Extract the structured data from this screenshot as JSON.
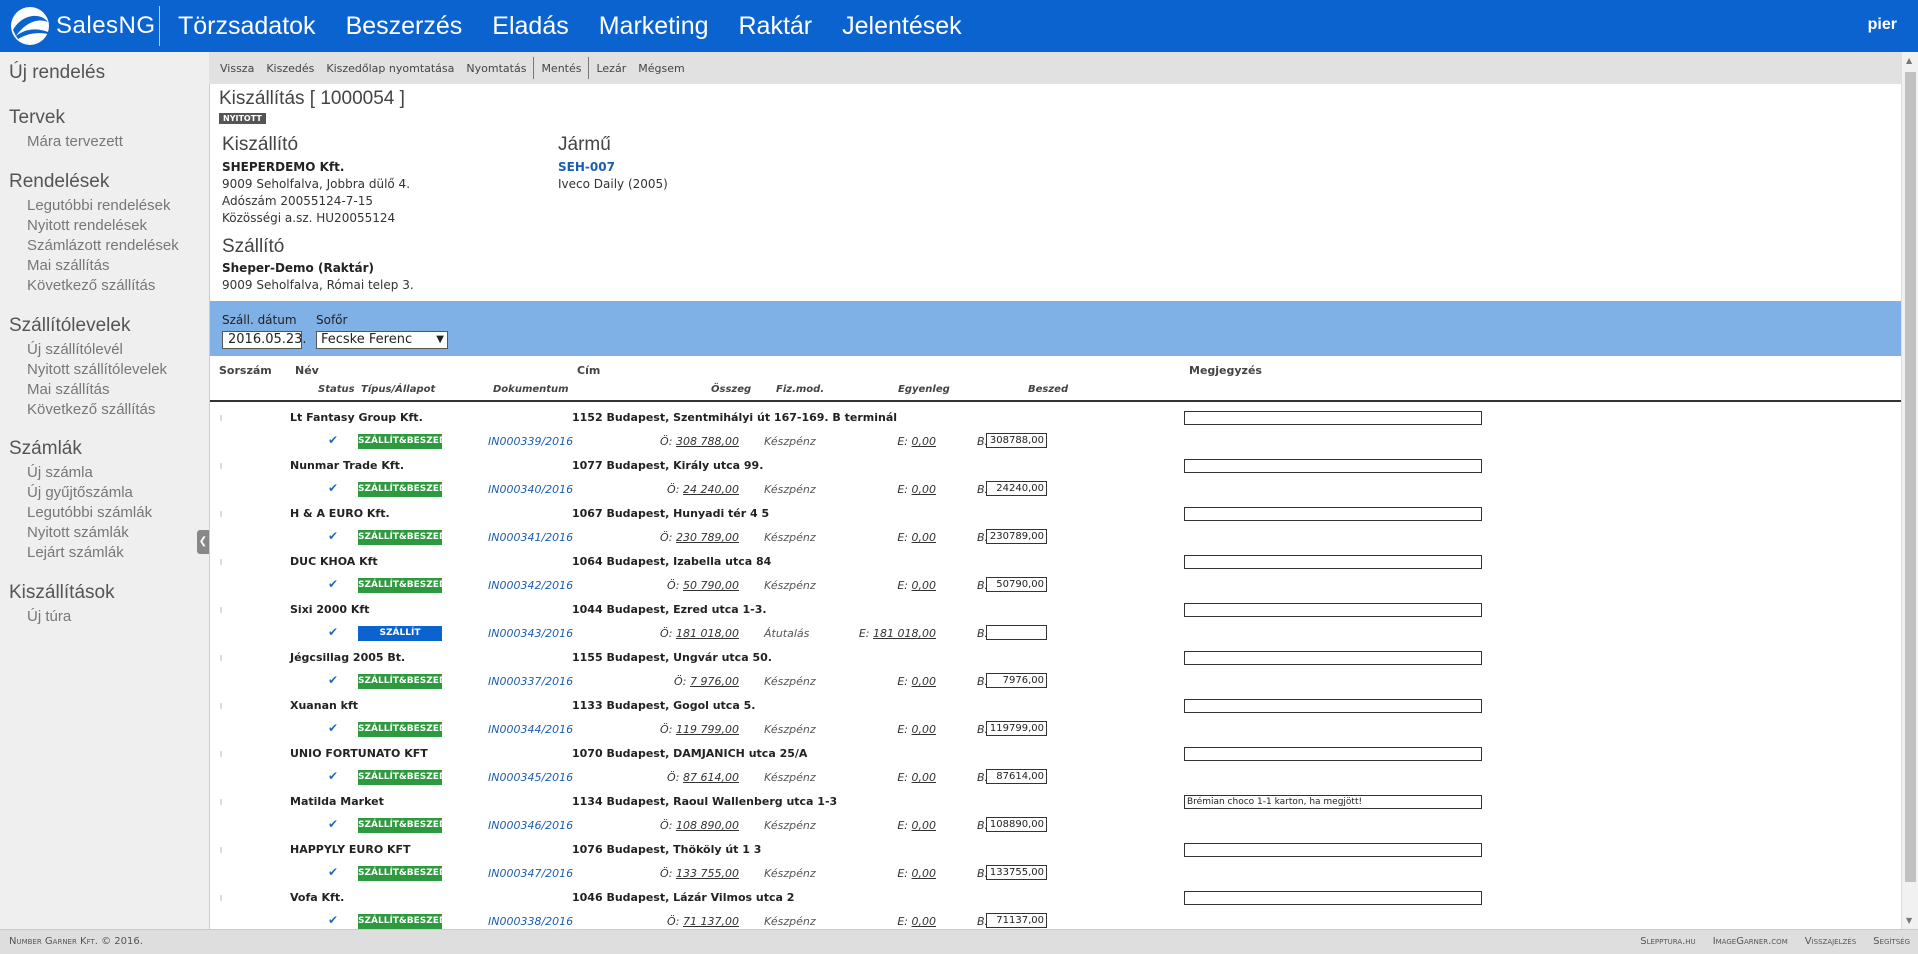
{
  "app": {
    "brand": "SalesNG",
    "user": "pier"
  },
  "nav": [
    "Törzsadatok",
    "Beszerzés",
    "Eladás",
    "Marketing",
    "Raktár",
    "Jelentések"
  ],
  "sidebar": [
    {
      "label": "Új rendelés",
      "items": []
    },
    {
      "label": "Tervek",
      "items": [
        "Mára tervezett"
      ]
    },
    {
      "label": "Rendelések",
      "items": [
        "Legutóbbi rendelések",
        "Nyitott rendelések",
        "Számlázott rendelések",
        "Mai szállítás",
        "Következő szállítás"
      ]
    },
    {
      "label": "Szállítólevelek",
      "items": [
        "Új szállítólevél",
        "Nyitott szállítólevelek",
        "Mai szállítás",
        "Következő szállítás"
      ]
    },
    {
      "label": "Számlák",
      "items": [
        "Új számla",
        "Új gyűjtőszámla",
        "Legutóbbi számlák",
        "Nyitott számlák",
        "Lejárt számlák"
      ]
    },
    {
      "label": "Kiszállítások",
      "items": [
        "Új túra"
      ]
    }
  ],
  "toolbar": [
    "Vissza",
    "Kiszedés",
    "Kiszedőlap nyomtatása",
    "Nyomtatás",
    "Mentés",
    "Lezár",
    "Mégsem"
  ],
  "page": {
    "title": "Kiszállítás [ 1000054 ]",
    "status": "NYITOTT"
  },
  "kiszallito": {
    "heading": "Kiszállító",
    "name": "SHEPERDEMO Kft.",
    "lines": [
      "9009 Seholfalva, Jobbra dülő 4.",
      "Adószám 20055124-7-15",
      "Közösségi a.sz. HU20055124"
    ]
  },
  "jarmu": {
    "heading": "Jármű",
    "plate": "SEH-007",
    "model": "Iveco Daily (2005)"
  },
  "szallito": {
    "heading": "Szállító",
    "name": "Sheper-Demo (Raktár)",
    "address": "9009 Seholfalva, Római telep 3."
  },
  "filters": {
    "date_label": "Száll. dátum",
    "date_value": "2016.05.23.",
    "driver_label": "Sofőr",
    "driver_value": "Fecske Ferenc"
  },
  "columns": {
    "sorszam": "Sorszám",
    "nev": "Név",
    "cim": "Cím",
    "megjegyzes": "Megjegyzés",
    "status": "Status",
    "tipus": "Típus/Állapot",
    "dokumentum": "Dokumentum",
    "osszeg": "Összeg",
    "fizmod": "Fiz.mod.",
    "egyenleg": "Egyenleg",
    "beszed": "Beszed"
  },
  "prefixes": {
    "o": "Ö:",
    "e": "E:",
    "b": "B:"
  },
  "rows": [
    {
      "name": "Lt Fantasy Group Kft.",
      "address": "1152 Budapest, Szentmihályi út 167-169. B terminál",
      "badge": "SZÁLLÍT&BESZED",
      "badge_color": "#2e9a3e",
      "doc": "IN000339/2016",
      "osszeg": "308 788,00",
      "fizmod": "Készpénz",
      "egyenleg": "0,00",
      "beszed": "308788,00",
      "note": ""
    },
    {
      "name": "Nunmar Trade Kft.",
      "address": "1077 Budapest, Király utca 99.",
      "badge": "SZÁLLÍT&BESZED",
      "badge_color": "#2e9a3e",
      "doc": "IN000340/2016",
      "osszeg": "24 240,00",
      "fizmod": "Készpénz",
      "egyenleg": "0,00",
      "beszed": "24240,00",
      "note": ""
    },
    {
      "name": "H & A EURO Kft.",
      "address": "1067 Budapest, Hunyadi tér 4 5",
      "badge": "SZÁLLÍT&BESZED",
      "badge_color": "#2e9a3e",
      "doc": "IN000341/2016",
      "osszeg": "230 789,00",
      "fizmod": "Készpénz",
      "egyenleg": "0,00",
      "beszed": "230789,00",
      "note": ""
    },
    {
      "name": "DUC KHOA Kft",
      "address": "1064 Budapest, Izabella utca 84",
      "badge": "SZÁLLÍT&BESZED",
      "badge_color": "#2e9a3e",
      "doc": "IN000342/2016",
      "osszeg": "50 790,00",
      "fizmod": "Készpénz",
      "egyenleg": "0,00",
      "beszed": "50790,00",
      "note": ""
    },
    {
      "name": "Sixi 2000 Kft",
      "address": "1044 Budapest, Ezred utca 1-3.",
      "badge": "SZÁLLÍT",
      "badge_color": "#0b63cf",
      "doc": "IN000343/2016",
      "osszeg": "181 018,00",
      "fizmod": "Átutalás",
      "egyenleg": "181 018,00",
      "beszed": "",
      "note": ""
    },
    {
      "name": "Jégcsillag 2005 Bt.",
      "address": "1155 Budapest, Ungvár utca 50.",
      "badge": "SZÁLLÍT&BESZED",
      "badge_color": "#2e9a3e",
      "doc": "IN000337/2016",
      "osszeg": "7 976,00",
      "fizmod": "Készpénz",
      "egyenleg": "0,00",
      "beszed": "7976,00",
      "note": ""
    },
    {
      "name": "Xuanan kft",
      "address": "1133 Budapest, Gogol utca 5.",
      "badge": "SZÁLLÍT&BESZED",
      "badge_color": "#2e9a3e",
      "doc": "IN000344/2016",
      "osszeg": "119 799,00",
      "fizmod": "Készpénz",
      "egyenleg": "0,00",
      "beszed": "119799,00",
      "note": ""
    },
    {
      "name": "UNIO FORTUNATO KFT",
      "address": "1070 Budapest, DAMJANICH utca 25/A",
      "badge": "SZÁLLÍT&BESZED",
      "badge_color": "#2e9a3e",
      "doc": "IN000345/2016",
      "osszeg": "87 614,00",
      "fizmod": "Készpénz",
      "egyenleg": "0,00",
      "beszed": "87614,00",
      "note": ""
    },
    {
      "name": "Matilda Market",
      "address": "1134 Budapest, Raoul Wallenberg utca 1-3",
      "badge": "SZÁLLÍT&BESZED",
      "badge_color": "#2e9a3e",
      "doc": "IN000346/2016",
      "osszeg": "108 890,00",
      "fizmod": "Készpénz",
      "egyenleg": "0,00",
      "beszed": "108890,00",
      "note": "Brémian choco 1-1 karton, ha megjött!"
    },
    {
      "name": "HAPPYLY EURO KFT",
      "address": "1076 Budapest, Thököly út 1 3",
      "badge": "SZÁLLÍT&BESZED",
      "badge_color": "#2e9a3e",
      "doc": "IN000347/2016",
      "osszeg": "133 755,00",
      "fizmod": "Készpénz",
      "egyenleg": "0,00",
      "beszed": "133755,00",
      "note": ""
    },
    {
      "name": "Vofa Kft.",
      "address": "1046 Budapest, Lázár Vilmos utca 2",
      "badge": "SZÁLLÍT&BESZED",
      "badge_color": "#2e9a3e",
      "doc": "IN000338/2016",
      "osszeg": "71 137,00",
      "fizmod": "Készpénz",
      "egyenleg": "0,00",
      "beszed": "71137,00",
      "note": ""
    }
  ],
  "footer": {
    "copyright": "Number Garner Kft. © 2016.",
    "links": [
      "Slepptura.hu",
      "ImageGarner.com",
      "Visszajelzés",
      "Segítség"
    ]
  }
}
